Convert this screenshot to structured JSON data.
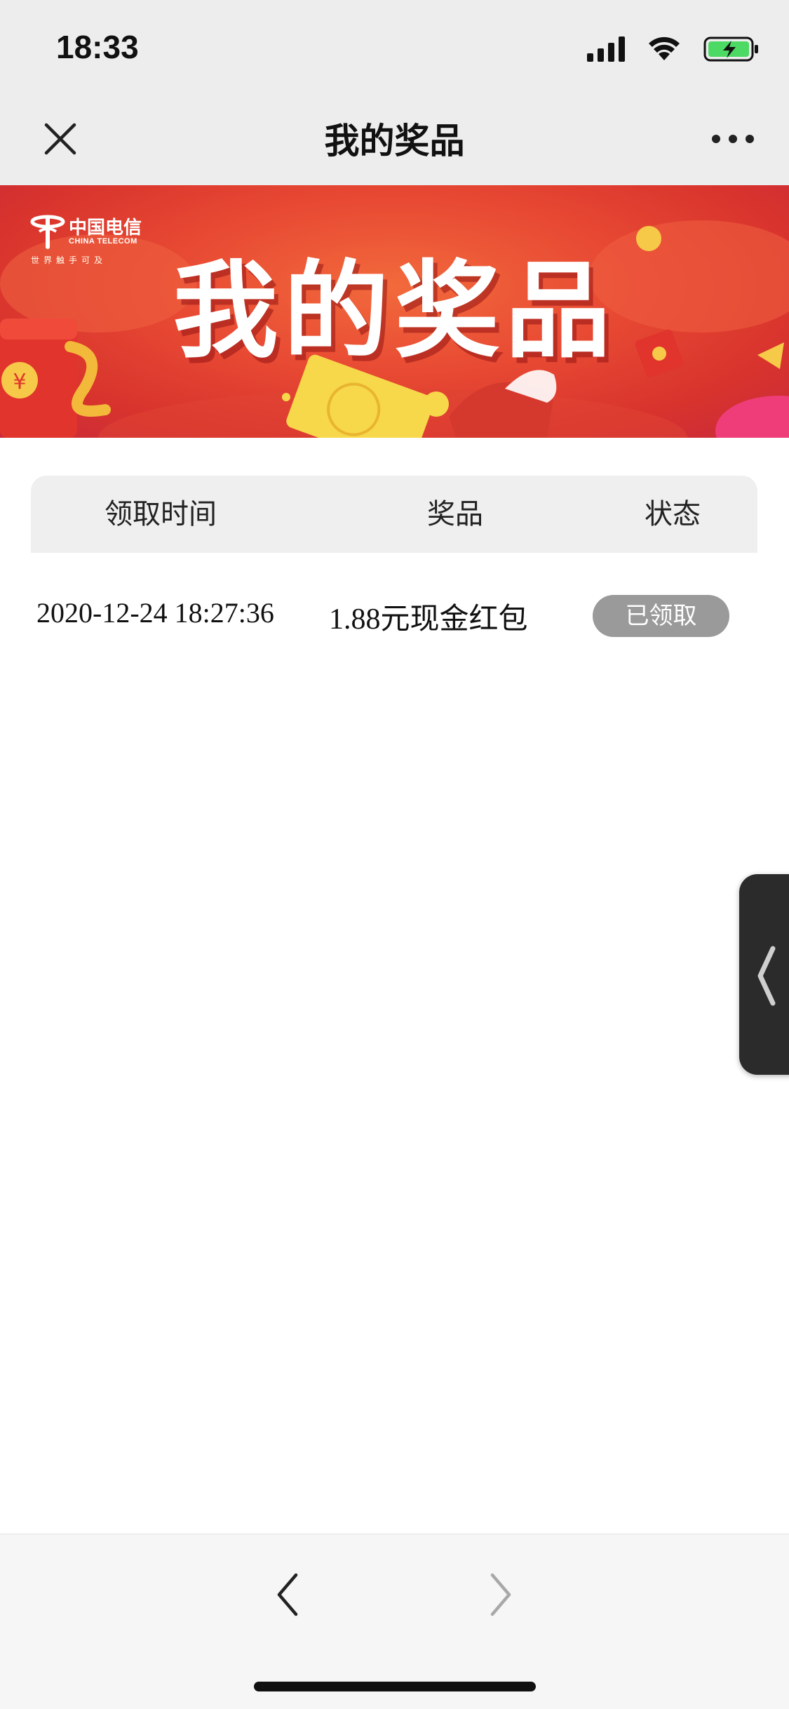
{
  "status_bar": {
    "time": "18:33",
    "icons": [
      "signal-icon",
      "wifi-icon",
      "battery-charging-icon"
    ]
  },
  "nav": {
    "title": "我的奖品",
    "left_icon": "close-icon",
    "right_icon": "more-icon"
  },
  "banner": {
    "title": "我的奖品",
    "logo": {
      "name_cn": "中国电信",
      "name_en": "CHINA TELECOM",
      "slogan": "世界触手可及"
    },
    "colors": {
      "primary": "#e84a33",
      "accent": "#f7c948"
    }
  },
  "table": {
    "headers": [
      "领取时间",
      "奖品",
      "状态"
    ],
    "rows": [
      {
        "time": "2020-12-24 18:27:36",
        "prize": "1.88元现金红包",
        "status": "已领取"
      }
    ]
  },
  "colors": {
    "status_badge": "#9a9a9a",
    "header_bg": "#efefef",
    "nav_bg": "#ededed"
  },
  "bottom_bar": {
    "back_icon": "chevron-left-icon",
    "forward_icon": "chevron-right-icon"
  },
  "side_handle": {
    "icon": "chevron-left-icon"
  }
}
